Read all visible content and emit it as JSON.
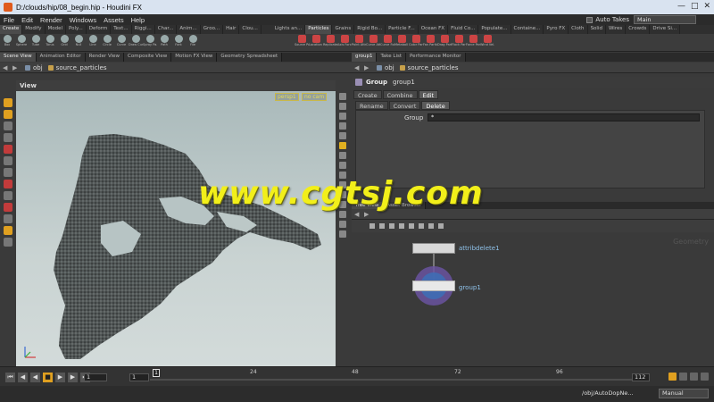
{
  "window": {
    "title": "D:/clouds/hip/08_begin.hip - Houdini FX"
  },
  "menu": [
    "File",
    "Edit",
    "Render",
    "Windows",
    "Assets",
    "Help"
  ],
  "takes": {
    "auto_takes_label": "Auto Takes",
    "current_take": "Main"
  },
  "shelf": {
    "tabs_left": [
      "Create",
      "Modify",
      "Model",
      "Poly...",
      "Deform",
      "Text...",
      "Riggi...",
      "Char...",
      "Anim...",
      "Groo...",
      "Hair",
      "Clou..."
    ],
    "tabs_right": [
      "Lights an...",
      "Particles",
      "Grains",
      "Rigid Bo...",
      "Particle F...",
      "Ocean FX",
      "Fluid Co...",
      "Populate...",
      "Containe...",
      "Pyro FX",
      "Cloth",
      "Solid",
      "Wires",
      "Crowds",
      "Drive Si..."
    ],
    "tools_left": [
      "Box",
      "Sphere",
      "Tube",
      "Torus",
      "Grid",
      "Null",
      "Line",
      "Circle",
      "Curve",
      "Draw Cur...",
      "Spray Pa...",
      "Path",
      "Font",
      "File"
    ],
    "tools_right": [
      "Source Part...",
      "Location Pa...",
      "Replicate P...",
      "Axis Force...",
      "Point Attr...",
      "Curve Attra...",
      "Curve Forc...",
      "Metaball Fo...",
      "Color Partic...",
      "Fan Partic...",
      "Drag Partic...",
      "Flock Partic...",
      "Force Partic...",
      "Wind Vel..."
    ]
  },
  "left_pane": {
    "tabs": [
      "Scene View",
      "Animation Editor",
      "Render View",
      "Composite View",
      "Motion FX View",
      "Geometry Spreadsheet"
    ],
    "path": [
      "obj",
      "source_particles"
    ],
    "view_label": "View",
    "camera": "persp1",
    "cam_mode": "no cam"
  },
  "right_pane": {
    "tabs": [
      "group1",
      "Take List",
      "Performance Monitor"
    ],
    "path": [
      "obj",
      "source_particles"
    ],
    "node_type": "Group",
    "node_name": "group1",
    "tabs_main": [
      "Create",
      "Combine",
      "Edit"
    ],
    "tabs_sub": [
      "Rename",
      "Convert",
      "Delete"
    ],
    "group_label": "Group",
    "group_value": "*"
  },
  "network": {
    "tabs": [
      "Tree View",
      "Asset Browser"
    ],
    "watermark": "Geometry",
    "nodes": [
      {
        "name": "attribdelete1"
      },
      {
        "name": "group1"
      }
    ]
  },
  "timeline": {
    "frame": "1",
    "start": "1",
    "ruler_labels": [
      "24",
      "48",
      "72",
      "96"
    ],
    "current": "1",
    "end": "112"
  },
  "status": {
    "path": "/obj/AutoDopNe...",
    "mode": "Manual"
  },
  "overlay": {
    "watermark": "www.cgtsj.com"
  },
  "colors": {
    "accent": "#e0a020",
    "watermark": "#f2ef1a",
    "node_label": "#8fc2ea"
  }
}
